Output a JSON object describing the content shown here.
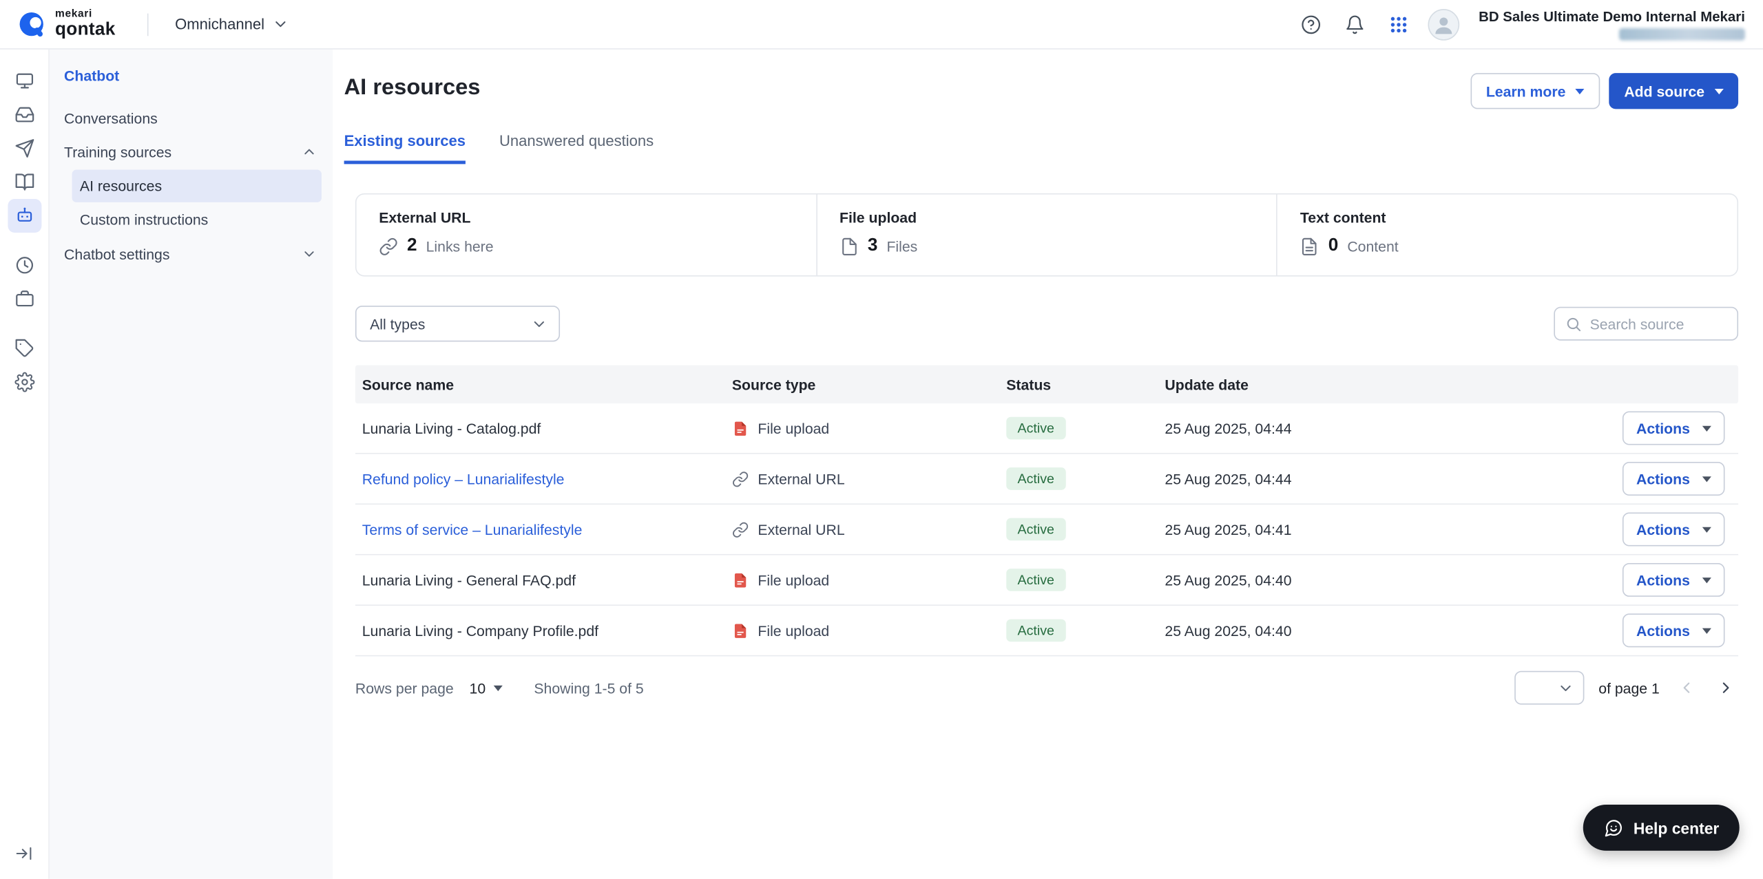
{
  "topbar": {
    "brand": {
      "line1": "mekari",
      "line2": "qontak"
    },
    "product_switcher": "Omnichannel",
    "user_name": "BD Sales Ultimate Demo Internal Mekari"
  },
  "sidebar": {
    "section_title": "Chatbot",
    "conversations": "Conversations",
    "training_sources": "Training sources",
    "ai_resources": "AI resources",
    "custom_instructions": "Custom instructions",
    "chatbot_settings": "Chatbot settings"
  },
  "header": {
    "title": "AI resources",
    "learn_more_label": "Learn more",
    "add_source_label": "Add source"
  },
  "tabs": [
    {
      "label": "Existing sources"
    },
    {
      "label": "Unanswered questions"
    }
  ],
  "stats": [
    {
      "label": "External URL",
      "count": "2",
      "unit": "Links here",
      "icon": "link-icon"
    },
    {
      "label": "File upload",
      "count": "3",
      "unit": "Files",
      "icon": "file-icon"
    },
    {
      "label": "Text content",
      "count": "0",
      "unit": "Content",
      "icon": "file-text-icon"
    }
  ],
  "filters": {
    "type_filter_value": "All types",
    "search_placeholder": "Search source"
  },
  "table": {
    "headers": [
      "Source name",
      "Source type",
      "Status",
      "Update date"
    ],
    "actions_label": "Actions",
    "rows": [
      {
        "name": "Lunaria Living - Catalog.pdf",
        "type": "File upload",
        "type_icon": "pdf-icon",
        "status": "Active",
        "updated": "25 Aug 2025, 04:44"
      },
      {
        "name": "Refund policy – Lunarialifestyle",
        "type": "External URL",
        "type_icon": "link-icon",
        "status": "Active",
        "updated": "25 Aug 2025, 04:44"
      },
      {
        "name": "Terms of service – Lunarialifestyle",
        "type": "External URL",
        "type_icon": "link-icon",
        "status": "Active",
        "updated": "25 Aug 2025, 04:41"
      },
      {
        "name": "Lunaria Living - General FAQ.pdf",
        "type": "File upload",
        "type_icon": "pdf-icon",
        "status": "Active",
        "updated": "25 Aug 2025, 04:40"
      },
      {
        "name": "Lunaria Living - Company Profile.pdf",
        "type": "File upload",
        "type_icon": "pdf-icon",
        "status": "Active",
        "updated": "25 Aug 2025, 04:40"
      }
    ]
  },
  "pagination": {
    "rows_per_page_label": "Rows per page",
    "rows_per_page_value": "10",
    "showing_text": "Showing 1-5 of 5",
    "of_page_text": "of page 1"
  },
  "help_button": {
    "label": "Help center"
  },
  "colors": {
    "accent": "#2B5FD9",
    "primary_button": "#2456C9",
    "active_badge_bg": "#E4F3E9",
    "active_badge_text": "#256B3E",
    "brand_blue": "#1D63ED",
    "pdf_red": "#E2574C"
  }
}
